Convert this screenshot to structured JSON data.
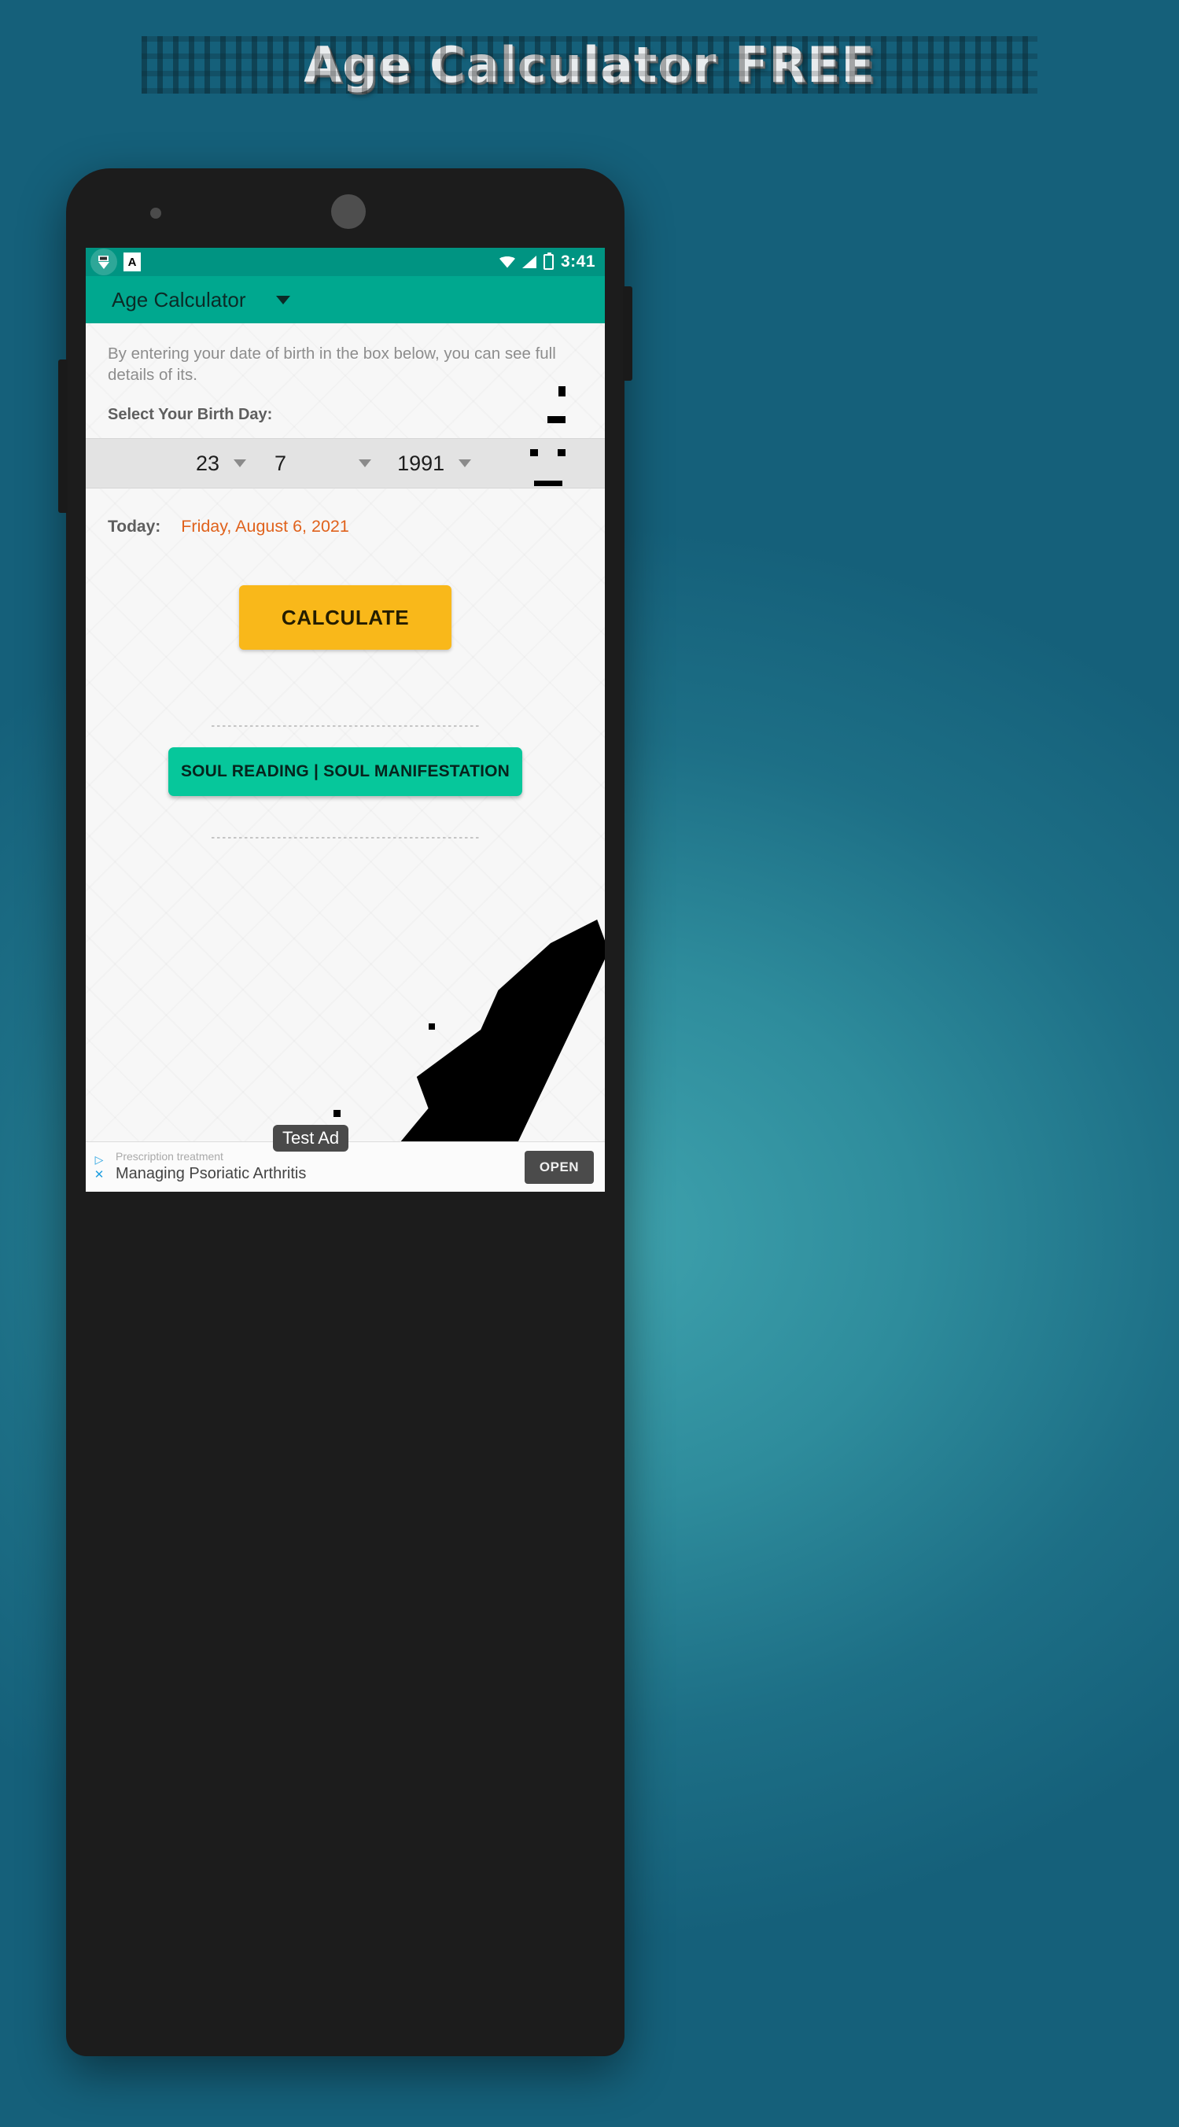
{
  "promo": {
    "title": "Age Calculator FREE"
  },
  "phone": {
    "status_bar": {
      "app_icon": "app-notification-icon",
      "secondary_icon": "A",
      "wifi_icon": "wifi-icon",
      "signal_icon": "signal-icon",
      "battery_icon": "battery-charging-icon",
      "time": "3:41"
    },
    "app_bar": {
      "title": "Age Calculator",
      "dropdown_icon": "caret-down-icon"
    },
    "content": {
      "intro_text": "By entering your date of birth in the box below, you can see full details of its.",
      "section_label": "Select Your Birth Day:",
      "date_picker": {
        "day": "23",
        "month": "7",
        "year": "1991",
        "arrow_icon": "caret-down-icon"
      },
      "today_label": "Today:",
      "today_value": "Friday, August 6, 2021",
      "calculate_button": "CALCULATE",
      "soul_button": "SOUL READING | SOUL MANIFESTATION"
    },
    "ad": {
      "adchoices_icon": "adchoices-icon",
      "close_icon": "close-icon",
      "line1": "Prescription treatment",
      "line2": "Managing Psoriatic Arthritis",
      "badge": "Test Ad",
      "open_button": "OPEN"
    }
  },
  "colors": {
    "background_teal": "#2e8c9c",
    "status_bar": "#009482",
    "app_bar": "#00a88f",
    "calculate_button": "#f9b81a",
    "soul_button": "#06c79b",
    "today_value": "#e0621c",
    "ad_icon_blue": "#1f9fe0"
  }
}
